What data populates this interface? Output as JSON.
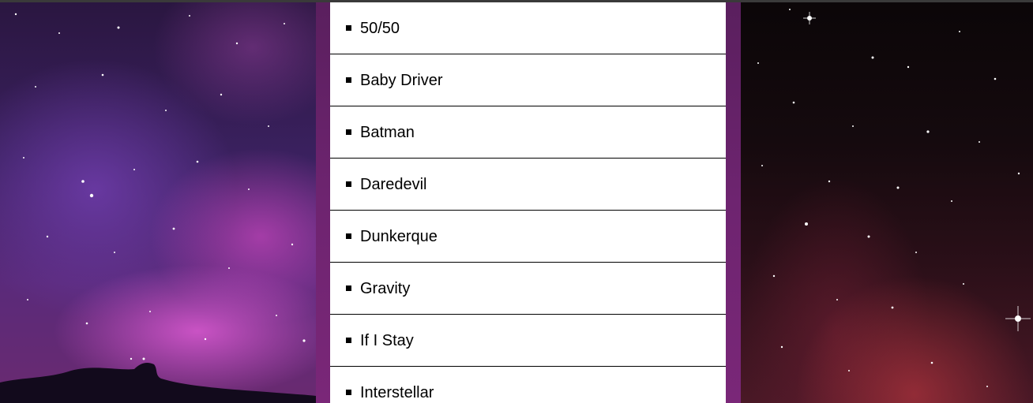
{
  "background": {
    "left_panel": "nebula-background",
    "right_panel": "starfield-background",
    "column_color": "#6e2470"
  },
  "movies": {
    "items": [
      {
        "label": "50/50"
      },
      {
        "label": "Baby Driver"
      },
      {
        "label": "Batman"
      },
      {
        "label": "Daredevil"
      },
      {
        "label": "Dunkerque"
      },
      {
        "label": "Gravity"
      },
      {
        "label": "If I Stay"
      },
      {
        "label": "Interstellar"
      }
    ],
    "bullet_icon": "square-bullet-icon"
  }
}
